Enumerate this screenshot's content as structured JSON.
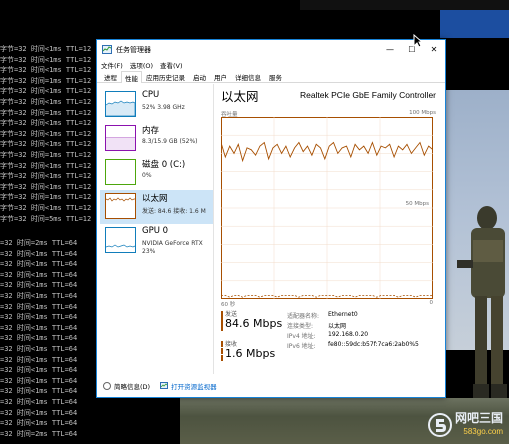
{
  "window": {
    "title": "任务管理器",
    "minimize": "—",
    "maximize": "☐",
    "close": "✕"
  },
  "menu": [
    "文件(F)",
    "选项(O)",
    "查看(V)"
  ],
  "tabs": [
    "进程",
    "性能",
    "应用历史记录",
    "启动",
    "用户",
    "详细信息",
    "服务"
  ],
  "active_tab": "性能",
  "sidebar": {
    "items": [
      {
        "name": "CPU",
        "sub": "52% 3.98 GHz",
        "sub2": "",
        "color": "#117dbb"
      },
      {
        "name": "内存",
        "sub": "8.3/15.9 GB (52%)",
        "sub2": "",
        "color": "#8b12ae"
      },
      {
        "name": "磁盘 0 (C:)",
        "sub": "0%",
        "sub2": "",
        "color": "#4da60c"
      },
      {
        "name": "以太网",
        "sub": "发送: 84.6 接收: 1.6 M",
        "sub2": "",
        "color": "#a74f01"
      },
      {
        "name": "GPU 0",
        "sub": "NVIDIA GeForce RTX",
        "sub2": "23%",
        "color": "#117dbb"
      }
    ]
  },
  "detail": {
    "title": "以太网",
    "adapter": "Realtek PCIe GbE Family Controller",
    "graph_label_left": "吞吐量",
    "graph_label_right": "100 Mbps",
    "graph_mid_label": "50 Mbps",
    "axis_left": "60 秒",
    "axis_right": "0",
    "send_label": "发送",
    "send_value": "84.6 Mbps",
    "recv_label": "接收",
    "recv_value": "1.6 Mbps",
    "send_color": "#a74f01",
    "recv_color": "#a74f01",
    "properties": [
      {
        "k": "适配器名称:",
        "v": "Ethernet0"
      },
      {
        "k": "连接类型:",
        "v": "以太网"
      },
      {
        "k": "IPv4 地址:",
        "v": "192.168.0.20"
      },
      {
        "k": "IPv6 地址:",
        "v": "fe80::59dc:b57f:7ca6:2ab0%5"
      }
    ]
  },
  "footer": {
    "fewer_details": "简略信息(D)",
    "open_monitor": "打开资源监视器"
  },
  "console_top": [
    "字节=32 时间<1ms TTL=12",
    "字节=32 时间<1ms TTL=12",
    "字节=32 时间<1ms TTL=12",
    "字节=32 时间=1ms TTL=12",
    "字节=32 时间<1ms TTL=12",
    "字节=32 时间<1ms TTL=12",
    "字节=32 时间=1ms TTL=12",
    "字节=32 时间<1ms TTL=12",
    "字节=32 时间<1ms TTL=12",
    "字节=32 时间<1ms TTL=12",
    "字节=32 时间=1ms TTL=12",
    "字节=32 时间<1ms TTL=12",
    "字节=32 时间<1ms TTL=12",
    "字节=32 时间<1ms TTL=12",
    "字节=32 时间=1ms TTL=12",
    "字节=32 时间<1ms TTL=12",
    "字节=32 时间=5ms TTL=12"
  ],
  "console_bottom": [
    "=32 时间=2ms TTL=64",
    "=32 时间<1ms TTL=64",
    "=32 时间<1ms TTL=64",
    "=32 时间<1ms TTL=64",
    "=32 时间<1ms TTL=64",
    "=32 时间<1ms TTL=64",
    "=32 时间<1ms TTL=64",
    "=32 时间<1ms TTL=64",
    "=32 时间<1ms TTL=64",
    "=32 时间<1ms TTL=64",
    "=32 时间<1ms TTL=64",
    "=32 时间<1ms TTL=64",
    "=32 时间<1ms TTL=64",
    "=32 时间<1ms TTL=64",
    "=32 时间<1ms TTL=64",
    "=32 时间<1ms TTL=64",
    "=32 时间<1ms TTL=64",
    "=32 时间<1ms TTL=64",
    "=32 时间=2ms TTL=64"
  ],
  "watermark": {
    "text": "网吧三国",
    "sub": "583go.com"
  },
  "chart_data": {
    "type": "line",
    "ylim": [
      0,
      100
    ],
    "series": [
      {
        "values": [
          86,
          78,
          84,
          80,
          85,
          76,
          83,
          82,
          79,
          84,
          86,
          77,
          83,
          85,
          80,
          84,
          78,
          83,
          86,
          81,
          84,
          79,
          85,
          83,
          77,
          84,
          86,
          80,
          83,
          84,
          78,
          85,
          82,
          84,
          80,
          86,
          79,
          84,
          83,
          85,
          78,
          84,
          82,
          85,
          80,
          83,
          86,
          79,
          84,
          82
        ]
      },
      {
        "values": [
          2,
          2,
          1,
          2,
          2,
          1,
          2,
          2,
          2,
          1,
          2,
          2,
          2,
          1,
          2,
          2,
          2,
          2,
          1,
          2,
          2,
          2,
          1,
          2,
          2,
          2,
          2,
          1,
          2,
          2,
          2,
          1,
          2,
          2,
          2,
          2,
          1,
          2,
          2,
          2,
          2,
          1,
          2,
          2,
          2,
          1,
          2,
          2,
          2,
          2
        ]
      }
    ]
  }
}
